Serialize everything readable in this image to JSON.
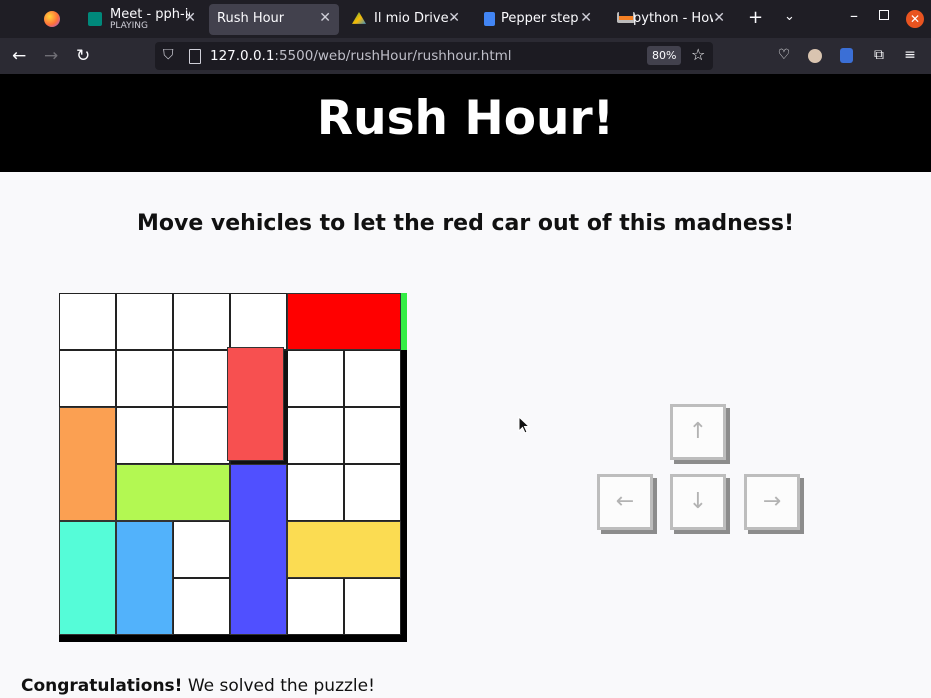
{
  "browser": {
    "tabs": [
      {
        "title": "Meet - pph-ieb",
        "subtitle": "PLAYING",
        "favicon_color": "#00897b",
        "active": false
      },
      {
        "title": "Rush Hour",
        "favicon_color": "",
        "active": true
      },
      {
        "title": "Il mio Drive - G",
        "favicon_color": "#1e88e5",
        "active": false
      },
      {
        "title": "Pepper steps",
        "favicon_color": "#4285f4",
        "active": false
      },
      {
        "title": "python - How",
        "favicon_color": "#f48024",
        "active": false
      }
    ],
    "url_host": "127.0.0.1",
    "url_path": ":5500/web/rushHour/rushhour.html",
    "zoom": "80%"
  },
  "page": {
    "title": "Rush Hour!",
    "subtitle": "Move vehicles to let the red car out of this madness!",
    "status_strong": "Congratulations!",
    "status_rest": " We solved the puzzle!"
  },
  "board": {
    "rows": 6,
    "cols": 6,
    "vehicles": [
      {
        "name": "red-car",
        "color": "#ff0000",
        "row": 0,
        "col": 4,
        "length": 2,
        "orientation": "horizontal"
      },
      {
        "name": "salmon-car",
        "color": "#f75050",
        "row": 1,
        "col": 3,
        "length": 2,
        "orientation": "vertical"
      },
      {
        "name": "orange-car",
        "color": "#fba052",
        "row": 2,
        "col": 0,
        "length": 2,
        "orientation": "vertical"
      },
      {
        "name": "lime-car",
        "color": "#b3f852",
        "row": 3,
        "col": 1,
        "length": 2,
        "orientation": "horizontal"
      },
      {
        "name": "blue-truck",
        "color": "#5050ff",
        "row": 3,
        "col": 3,
        "length": 3,
        "orientation": "vertical"
      },
      {
        "name": "yellow-car",
        "color": "#fbdc52",
        "row": 4,
        "col": 4,
        "length": 2,
        "orientation": "horizontal"
      },
      {
        "name": "cyan-car",
        "color": "#55fcd8",
        "row": 4,
        "col": 0,
        "length": 2,
        "orientation": "vertical"
      },
      {
        "name": "sky-car",
        "color": "#52b2fb",
        "row": 4,
        "col": 1,
        "length": 2,
        "orientation": "vertical"
      }
    ]
  },
  "controls": {
    "up": "↑",
    "left": "←",
    "down": "↓",
    "right": "→"
  }
}
